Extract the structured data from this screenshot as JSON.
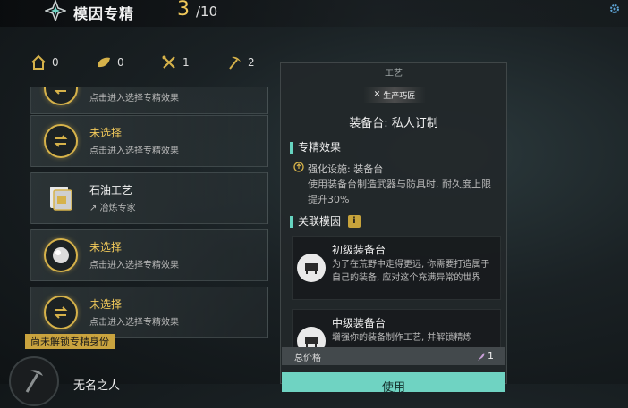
{
  "header": {
    "title": "模因专精",
    "count": "3",
    "total": "/10",
    "logo_icon": "compass-star-icon",
    "corner_icon": "gear-icon"
  },
  "stats": [
    {
      "icon": "home-icon",
      "value": "0"
    },
    {
      "icon": "leaf-icon",
      "value": "0"
    },
    {
      "icon": "crossed-tools-icon",
      "value": "1"
    },
    {
      "icon": "pickaxe-icon",
      "value": "2"
    }
  ],
  "list": [
    {
      "title": "",
      "sub": "点击进入选择专精效果",
      "type": "empty"
    },
    {
      "title": "未选择",
      "sub": "点击进入选择专精效果",
      "type": "empty"
    },
    {
      "title": "石油工艺",
      "sub": "冶炼专家",
      "type": "selected"
    },
    {
      "title": "未选择",
      "sub": "点击进入选择专精效果",
      "type": "empty"
    },
    {
      "title": "未选择",
      "sub": "点击进入选择专精效果",
      "type": "empty"
    }
  ],
  "panel": {
    "category": "工艺",
    "badge": "生产巧匠",
    "name": "装备台: 私人订制",
    "effect_head": "专精效果",
    "effect_title": "强化设施: 装备台",
    "effect_desc": "使用装备台制造武器与防具时, 耐久度上限提升30%",
    "related_head": "关联模因",
    "info_icon": "i",
    "genes": [
      {
        "title": "初级装备台",
        "desc": "为了在荒野中走得更远, 你需要打造属于自己的装备, 应对这个充满异常的世界"
      },
      {
        "title": "中级装备台",
        "desc": "增强你的装备制作工艺, 并解锁精炼"
      }
    ],
    "price_label": "总价格",
    "price_value": "1",
    "button": "使用"
  },
  "footer": {
    "locked_tag": "尚未解锁专精身份",
    "name": "无名之人"
  },
  "colors": {
    "accent_gold": "#f0c85a",
    "accent_teal": "#6fd3c2"
  }
}
